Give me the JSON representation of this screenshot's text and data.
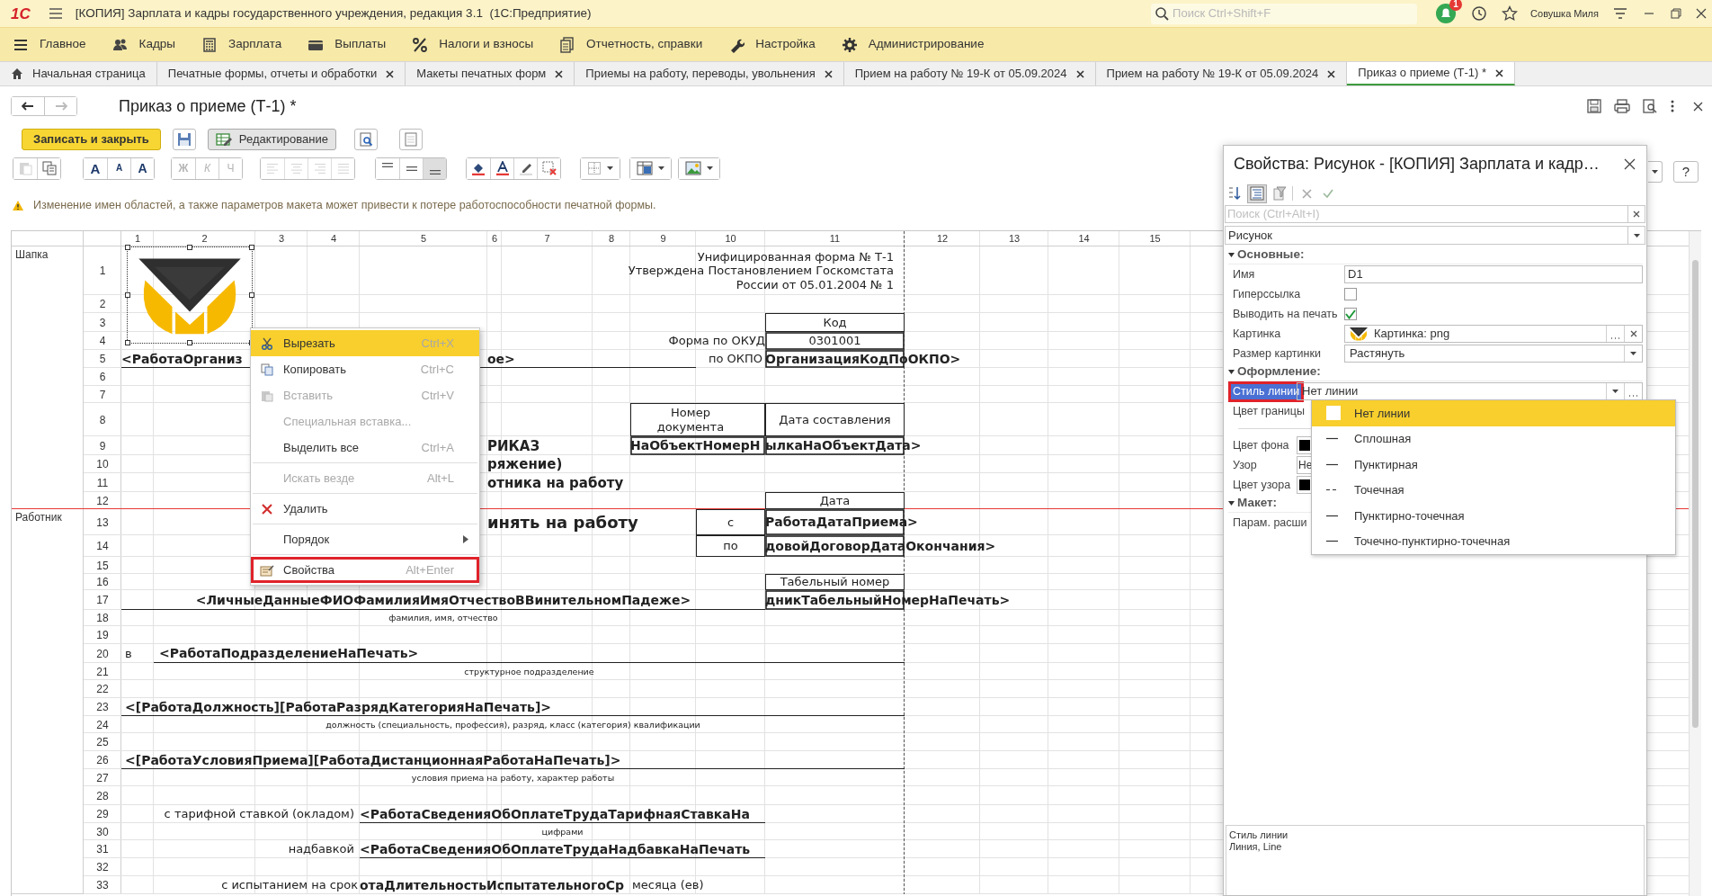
{
  "window": {
    "logo": "1С",
    "title": "[КОПИЯ] Зарплата и кадры государственного учреждения, редакция 3.1  (1С:Предприятие)",
    "search_placeholder": "Поиск Ctrl+Shift+F",
    "notifications": "1",
    "user": "Совушка Миля"
  },
  "sections": [
    {
      "label": "Главное"
    },
    {
      "label": "Кадры"
    },
    {
      "label": "Зарплата"
    },
    {
      "label": "Выплаты"
    },
    {
      "label": "Налоги и взносы"
    },
    {
      "label": "Отчетность, справки"
    },
    {
      "label": "Настройка"
    },
    {
      "label": "Администрирование"
    }
  ],
  "tabs": [
    {
      "label": "Начальная страница",
      "kind": "home",
      "selected": false
    },
    {
      "label": "Печатные формы, отчеты и обработки",
      "kind": "page",
      "selected": false
    },
    {
      "label": "Макеты печатных форм",
      "kind": "page",
      "selected": false
    },
    {
      "label": "Приемы на работу, переводы, увольнения",
      "kind": "page",
      "selected": false
    },
    {
      "label": "Прием на работу № 19-К от 05.09.2024",
      "kind": "page",
      "selected": false
    },
    {
      "label": "Прием на работу № 19-К от 05.09.2024",
      "kind": "page",
      "selected": false
    },
    {
      "label": "Приказ о приеме (Т-1) *",
      "kind": "page",
      "selected": true
    }
  ],
  "form": {
    "title": "Приказ о приеме (Т-1) *",
    "back": {
      "disabled": false
    },
    "forward": {
      "disabled": true
    },
    "help": "?"
  },
  "commands": [
    {
      "kind": "primary",
      "label": "Записать и закрыть",
      "pressed": false
    },
    {
      "kind": "save",
      "pressed": false
    },
    {
      "kind": "toggle",
      "label": "Редактирование",
      "pressed": true
    },
    {
      "kind": "preview",
      "pressed": false
    },
    {
      "kind": "page",
      "pressed": false
    }
  ],
  "format_toolbar": [
    [
      {
        "kind": "paste",
        "disabled": true
      },
      {
        "kind": "copy",
        "disabled": false
      }
    ],
    [
      {
        "kind": "font",
        "glyph": "A",
        "disabled": false
      },
      {
        "kind": "smaller",
        "glyph": "A",
        "disabled": false
      },
      {
        "kind": "larger",
        "glyph": "A",
        "disabled": false
      }
    ],
    [
      {
        "kind": "bold",
        "glyph": "Ж",
        "disabled": true
      },
      {
        "kind": "italic",
        "glyph": "К",
        "disabled": true
      },
      {
        "kind": "underline",
        "glyph": "Ч",
        "disabled": true
      }
    ],
    [
      {
        "kind": "align-left",
        "disabled": true
      },
      {
        "kind": "align-center",
        "disabled": true
      },
      {
        "kind": "align-right",
        "disabled": true
      },
      {
        "kind": "align-justify",
        "disabled": true
      }
    ],
    [
      {
        "kind": "valign-top",
        "disabled": false,
        "pressed": false
      },
      {
        "kind": "valign-middle",
        "disabled": false,
        "pressed": false
      },
      {
        "kind": "valign-bottom",
        "disabled": false,
        "pressed": true
      }
    ],
    [
      {
        "kind": "fill-color",
        "disabled": false
      },
      {
        "kind": "text-color",
        "disabled": false
      },
      {
        "kind": "highlight",
        "disabled": false
      },
      {
        "kind": "clear",
        "disabled": false
      }
    ],
    [
      {
        "kind": "borders",
        "disabled": false
      }
    ],
    [
      {
        "kind": "table",
        "disabled": false
      }
    ],
    [
      {
        "kind": "image",
        "disabled": false
      }
    ]
  ],
  "warning": "Изменение имен областей, а также параметров макета может привести к потере работоспособности печатной формы.",
  "sheet": {
    "columns": [
      "1",
      "2",
      "3",
      "4",
      "5",
      "6",
      "7",
      "8",
      "9",
      "10",
      "11",
      "12",
      "13",
      "14",
      "15"
    ],
    "picture": {
      "selected": true
    },
    "rows": [
      {
        "number": "1",
        "section": "Шапка",
        "cells": [
          "",
          "",
          "",
          "",
          "",
          "",
          "",
          "",
          "",
          {
            "text": "Унифицированная форма № Т-1\nУтверждена Постановлением Госкомстата\nРоссии от 05.01.2004 № 1",
            "kind": "label"
          }
        ]
      },
      {
        "number": "2",
        "cells": []
      },
      {
        "number": "3",
        "cells": [
          "",
          "",
          "",
          "",
          "",
          "",
          "",
          "",
          "",
          "",
          {
            "text": "Код",
            "kind": "label"
          }
        ]
      },
      {
        "number": "4",
        "cells": [
          "",
          "",
          "",
          "",
          "",
          "",
          "",
          "",
          "",
          {
            "text": "Форма по ОКУД",
            "kind": "label"
          },
          {
            "text": "0301001",
            "kind": "label"
          }
        ]
      },
      {
        "number": "5",
        "cells": [
          "",
          {
            "text": "<РаботаОрганиз",
            "kind": "field"
          },
          "",
          "",
          "",
          {
            "text": "ое>",
            "kind": "field"
          },
          "",
          "",
          "",
          {
            "text": "по ОКПО",
            "kind": "label"
          },
          {
            "text": "ОрганизацияКодПоОКПО>",
            "kind": "field"
          }
        ]
      },
      {
        "number": "6",
        "cells": []
      },
      {
        "number": "7",
        "cells": []
      },
      {
        "number": "8",
        "cells": [
          "",
          "",
          "",
          "",
          "",
          "",
          "",
          "",
          {
            "text": "Номер\nдокумента",
            "kind": "label"
          },
          "",
          {
            "text": "Дата составления",
            "kind": "label"
          }
        ]
      },
      {
        "number": "9",
        "cells": [
          "",
          "",
          "",
          "",
          "",
          "",
          {
            "text": "РИКАЗ",
            "kind": "title"
          },
          "",
          {
            "text": "НаОбъектНомерН",
            "kind": "field"
          },
          "",
          {
            "text": "ылкаНаОбъектДата>",
            "kind": "field"
          }
        ]
      },
      {
        "number": "10",
        "cells": [
          "",
          "",
          "",
          "",
          "",
          "",
          {
            "text": "ряжение)",
            "kind": "title"
          }
        ]
      },
      {
        "number": "11",
        "cells": [
          "",
          "",
          "",
          "",
          "",
          "",
          {
            "text": "отника на работу",
            "kind": "title"
          }
        ]
      },
      {
        "number": "12",
        "cells": [
          "",
          "",
          "",
          "",
          "",
          "",
          "",
          "",
          "",
          "",
          {
            "text": "Дата",
            "kind": "label"
          }
        ]
      },
      {
        "number": "13",
        "section": "Работник",
        "cells": [
          "",
          "",
          "",
          "",
          "",
          "",
          {
            "text": "инять на работу",
            "kind": "heading"
          },
          "",
          "",
          {
            "text": "с",
            "kind": "label"
          },
          {
            "text": "РаботаДатаПриема>",
            "kind": "field"
          }
        ]
      },
      {
        "number": "14",
        "cells": [
          "",
          "",
          "",
          "",
          "",
          "",
          "",
          "",
          "",
          {
            "text": "по",
            "kind": "label"
          },
          {
            "text": "довойДоговорДатаОкончания>",
            "kind": "field"
          }
        ]
      },
      {
        "number": "15",
        "cells": []
      },
      {
        "number": "16",
        "cells": [
          "",
          "",
          "",
          "",
          "",
          "",
          "",
          "",
          "",
          "",
          {
            "text": "Табельный номер",
            "kind": "label"
          }
        ]
      },
      {
        "number": "17",
        "cells": [
          "",
          "",
          "",
          "",
          {
            "text": "<ЛичныеДанныеФИОФамилияИмяОтчествоВВинительномПадеже>",
            "kind": "field"
          },
          "",
          "",
          "",
          "",
          "",
          {
            "text": "дникТабельныйНомерНаПечать>",
            "kind": "field"
          }
        ]
      },
      {
        "number": "18",
        "cells": [
          "",
          "",
          "",
          "",
          {
            "text": "фамилия, имя, отчество",
            "kind": "caption"
          }
        ]
      },
      {
        "number": "19",
        "cells": []
      },
      {
        "number": "20",
        "cells": [
          {
            "text": "в",
            "kind": "label"
          },
          "",
          {
            "text": "<РаботаПодразделениеНаПечать>",
            "kind": "field"
          }
        ]
      },
      {
        "number": "21",
        "cells": [
          "",
          "",
          "",
          "",
          "",
          "",
          {
            "text": "структурное подразделение",
            "kind": "caption"
          }
        ]
      },
      {
        "number": "22",
        "cells": []
      },
      {
        "number": "23",
        "cells": [
          "",
          "",
          "",
          {
            "text": "<[РаботаДолжность][РаботаРазрядКатегорияНаПечать]>",
            "kind": "field"
          }
        ]
      },
      {
        "number": "24",
        "cells": [
          "",
          "",
          "",
          "",
          "",
          "",
          {
            "text": "должность (специальность, профессия), разряд, класс (категория) квалификации",
            "kind": "caption"
          }
        ]
      },
      {
        "number": "25",
        "cells": []
      },
      {
        "number": "26",
        "cells": [
          "",
          "",
          "",
          "",
          {
            "text": "<[РаботаУсловияПриема][РаботаДистанционнаяРаботаНаПечать]>",
            "kind": "field"
          }
        ]
      },
      {
        "number": "27",
        "cells": [
          "",
          "",
          "",
          "",
          "",
          "",
          {
            "text": "условия приема на работу, характер работы",
            "kind": "caption"
          }
        ]
      },
      {
        "number": "28",
        "cells": []
      },
      {
        "number": "29",
        "cells": [
          "",
          {
            "text": "с тарифной ставкой (окладом)",
            "kind": "label"
          },
          "",
          "",
          "",
          "",
          {
            "text": "<РаботаСведенияОбОплатеТрудаТарифнаяСтавкаНа",
            "kind": "field"
          }
        ]
      },
      {
        "number": "30",
        "cells": [
          "",
          "",
          "",
          "",
          "",
          "",
          {
            "text": "цифрами",
            "kind": "caption"
          }
        ]
      },
      {
        "number": "31",
        "cells": [
          "",
          "",
          "",
          {
            "text": "надбавкой",
            "kind": "label"
          },
          "",
          "",
          {
            "text": "<РаботаСведенияОбОплатеТрудаНадбавкаНаПечать",
            "kind": "field"
          }
        ]
      },
      {
        "number": "32",
        "cells": []
      },
      {
        "number": "33",
        "cells": [
          "",
          "",
          {
            "text": "с испытанием на срок",
            "kind": "label"
          },
          "",
          "",
          {
            "text": "отаДлительностьИспытательногоСр",
            "kind": "field"
          },
          "",
          "",
          {
            "text": "месяца (ев)",
            "kind": "label"
          }
        ]
      }
    ]
  },
  "context_menu": [
    [
      {
        "label": "Вырезать",
        "shortcut": "Ctrl+X",
        "kind": "cut",
        "disabled": false,
        "selected": true,
        "submenu": false,
        "framed": false
      },
      {
        "label": "Копировать",
        "shortcut": "Ctrl+C",
        "kind": "copy",
        "disabled": false,
        "selected": false,
        "submenu": false,
        "framed": false
      },
      {
        "label": "Вставить",
        "shortcut": "Ctrl+V",
        "kind": "paste",
        "disabled": true,
        "selected": false,
        "submenu": false,
        "framed": false
      },
      {
        "label": "Специальная вставка...",
        "kind": "plain",
        "disabled": true,
        "selected": false,
        "submenu": false,
        "framed": false
      },
      {
        "label": "Выделить все",
        "shortcut": "Ctrl+A",
        "kind": "plain",
        "disabled": false,
        "selected": false,
        "submenu": false,
        "framed": false
      }
    ],
    [
      {
        "label": "Искать везде",
        "shortcut": "Alt+L",
        "kind": "plain",
        "disabled": true,
        "selected": false,
        "submenu": false,
        "framed": false
      }
    ],
    [
      {
        "label": "Удалить",
        "kind": "delete",
        "disabled": false,
        "selected": false,
        "submenu": false,
        "framed": false
      }
    ],
    [
      {
        "label": "Порядок",
        "kind": "plain",
        "disabled": false,
        "selected": false,
        "submenu": true,
        "framed": false
      }
    ],
    [
      {
        "label": "Свойства",
        "shortcut": "Alt+Enter",
        "kind": "properties",
        "disabled": false,
        "selected": false,
        "submenu": false,
        "framed": true
      }
    ]
  ],
  "properties": {
    "title": "Свойства: Рисунок - [КОПИЯ] Зарплата и кадр…",
    "search_placeholder": "Поиск (Ctrl+Alt+I)",
    "object": "Рисунок",
    "groups": [
      {
        "label": "Основные:",
        "expanded": true,
        "rows": [
          {
            "label": "Имя",
            "kind": "text",
            "value": "D1",
            "selected": false,
            "framed": false
          },
          {
            "label": "Гиперссылка",
            "kind": "checkbox",
            "checked": false,
            "selected": false,
            "framed": false
          },
          {
            "label": "Выводить на печать",
            "kind": "checkbox",
            "checked": true,
            "selected": false,
            "framed": false
          },
          {
            "label": "Картинка",
            "kind": "picture",
            "value": "Картинка: png",
            "selected": false,
            "framed": false
          },
          {
            "label": "Размер картинки",
            "kind": "select",
            "value": "Растянуть",
            "selected": false,
            "framed": false
          }
        ]
      },
      {
        "label": "Оформление:",
        "expanded": true,
        "rows": [
          {
            "label": "Стиль линии",
            "kind": "select",
            "value": "Нет линии",
            "selected": true,
            "framed": true
          },
          {
            "label": "Цвет границы",
            "kind": "none",
            "selected": false,
            "framed": false
          },
          {
            "kind": "divider"
          },
          {
            "label": "Цвет фона",
            "kind": "color",
            "color": "#000000",
            "selected": false,
            "framed": false
          },
          {
            "label": "Узор",
            "kind": "clipped",
            "value": "Не",
            "selected": false,
            "framed": false
          },
          {
            "label": "Цвет узора",
            "kind": "color",
            "color": "#000000",
            "selected": false,
            "framed": false
          }
        ]
      },
      {
        "label": "Макет:",
        "expanded": true,
        "rows": [
          {
            "label": "Парам. расши",
            "kind": "none",
            "selected": false,
            "framed": false
          }
        ]
      }
    ],
    "description": [
      "Стиль линии",
      "Линия, Line"
    ]
  },
  "line_styles": [
    {
      "label": "Нет линии",
      "kind": "none",
      "selected": true
    },
    {
      "label": "Сплошная",
      "kind": "solid",
      "selected": false
    },
    {
      "label": "Пунктирная",
      "kind": "dashed",
      "selected": false
    },
    {
      "label": "Точечная",
      "kind": "dotted",
      "selected": false
    },
    {
      "label": "Пунктирно-точечная",
      "kind": "dashdot",
      "selected": false
    },
    {
      "label": "Точечно-пунктирно-точечная",
      "kind": "dotdashdot",
      "selected": false
    }
  ]
}
